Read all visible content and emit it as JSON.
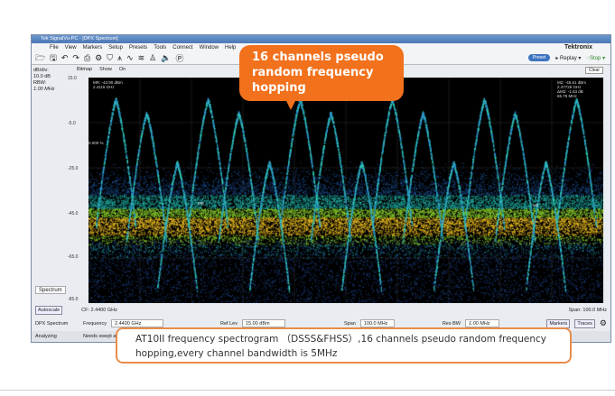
{
  "window": {
    "title": "Tek SignalVu-PC - [DPX Spectrum]",
    "brand": "Tektronix"
  },
  "menu": [
    "File",
    "View",
    "Markers",
    "Setup",
    "Presets",
    "Tools",
    "Connect",
    "Window",
    "Help"
  ],
  "toolbar": {
    "preset": "Preset",
    "replay": "▸ Replay ▾",
    "stop": "◌Stop ▾"
  },
  "display": {
    "bitmap": "Bitmap",
    "show": "Show",
    "on": "On",
    "clear": "Clear"
  },
  "left_panel": {
    "db_div_label": "dB/div:",
    "db_div": "10.0 dB",
    "rbw_label": "RBW:",
    "rbw": "1.00 MHz",
    "mode": "Spectrum",
    "autoscale": "Autoscale"
  },
  "y_ticks": [
    "15.0",
    "-5.0",
    "-25.0",
    "-45.0",
    "-65.0",
    "-85.0"
  ],
  "markers": {
    "mr": "MR: -43.90 dBm",
    "mr_freq": "2.4116 GHz",
    "m2": "M2: -45.61 dBm",
    "m2_freq": "2.47726 GHz",
    "dm2": "ΔM2: -1.53 dB",
    "dm2_freq": "65.75 MHz",
    "pct": "0.000 %",
    "m1": "MR",
    "m2_tag": "M2"
  },
  "axis": {
    "cf": "CF: 2.4400 GHz",
    "span": "Span: 100.0 MHz"
  },
  "controls": {
    "name": "DPX Spectrum",
    "frequency_label": "Frequency",
    "frequency": "2.4400 GHz",
    "ref_lev_label": "Ref Lev",
    "ref_lev": "15.00 dBm",
    "span_label": "Span",
    "span": "100.0 MHz",
    "res_bw_label": "Res BW",
    "res_bw": "1.00 MHz",
    "markers": "Markers",
    "traces": "Traces"
  },
  "status": {
    "state": "Analyzing",
    "message": "Needs swept acq"
  },
  "callout": "16 channels pseudo random frequency hopping",
  "caption": "AT10II frequency spectrogram （DSSS&FHSS）,16 channels pseudo random frequency hopping,every channel bandwidth is 5MHz",
  "chart_data": {
    "type": "scatter",
    "title": "DPX Spectrum",
    "ylabel": "dBm",
    "ylim": [
      -85,
      15
    ],
    "center_freq_ghz": 2.44,
    "span_mhz": 100,
    "channels": 16,
    "channel_bandwidth_mhz": 5
  }
}
